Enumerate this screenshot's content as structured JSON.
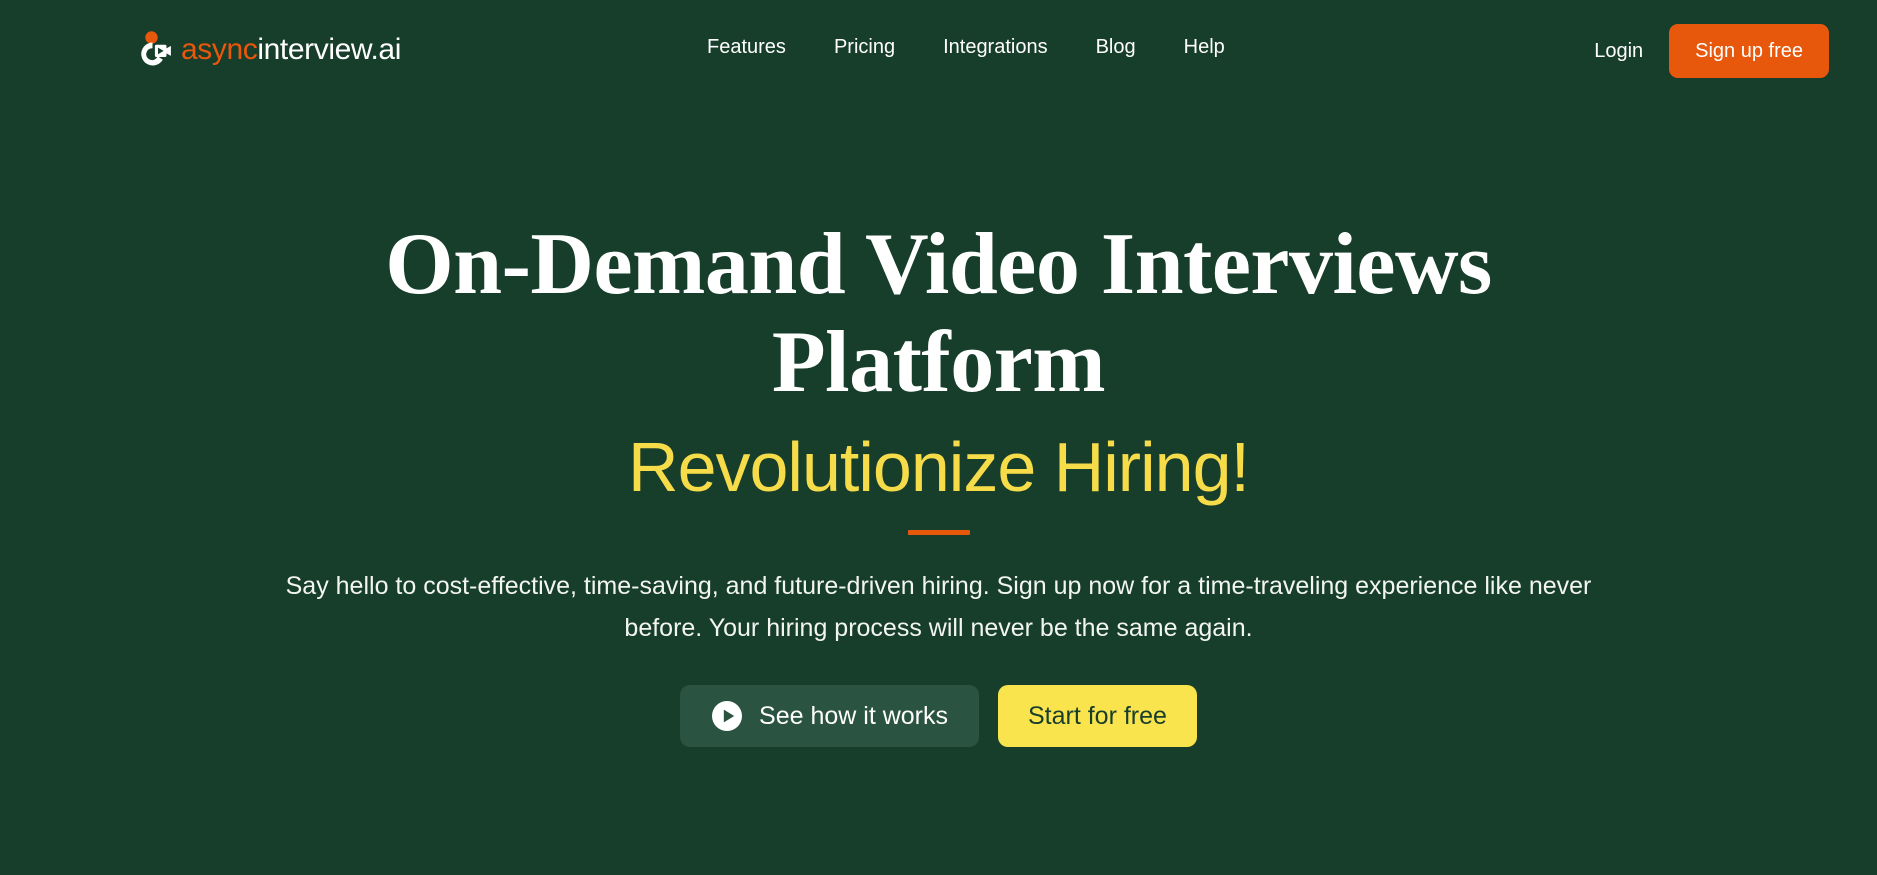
{
  "theme": {
    "background": "#173D2B",
    "accent_orange": "#E8580C",
    "accent_yellow": "#F7DC4A",
    "button_yellow": "#FAE44E",
    "ghost_button": "#2B5341",
    "text_white": "#FFFFFF"
  },
  "header": {
    "logo": {
      "icon_name": "asyncinterview-logo-icon",
      "text_primary": "async",
      "text_secondary": "interview.ai"
    },
    "nav": [
      {
        "label": "Features"
      },
      {
        "label": "Pricing"
      },
      {
        "label": "Integrations"
      },
      {
        "label": "Blog"
      },
      {
        "label": "Help"
      }
    ],
    "login_label": "Login",
    "signup_label": "Sign up free"
  },
  "hero": {
    "headline": "On-Demand Video Interviews Platform",
    "subheadline": "Revolutionize Hiring!",
    "lede": "Say hello to cost-effective, time-saving, and future-driven hiring. Sign up now for a time-traveling experience like never before. Your hiring process will never be the same again.",
    "primary_cta": "See how it works",
    "secondary_cta": "Start for free"
  }
}
